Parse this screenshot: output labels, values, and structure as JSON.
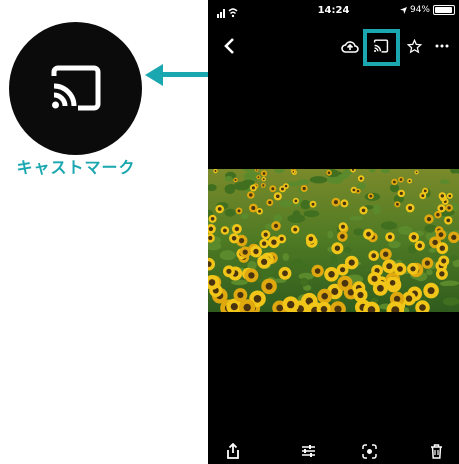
{
  "callout": {
    "label": "キャストマーク",
    "accent_color": "#1aa7b0",
    "icon": "cast-icon"
  },
  "status_bar": {
    "time": "14:24",
    "battery": "94%"
  },
  "toolbar": {
    "back_icon": "chevron-left-icon",
    "upload_icon": "cloud-upload-icon",
    "cast_icon": "cast-icon",
    "favorite_icon": "star-outline-icon",
    "more_icon": "more-horizontal-icon"
  },
  "bottom_toolbar": {
    "share_icon": "share-icon",
    "edit_icon": "sliders-icon",
    "lens_icon": "lens-icon",
    "delete_icon": "trash-icon"
  },
  "photo": {
    "subject": "sunflower field"
  }
}
